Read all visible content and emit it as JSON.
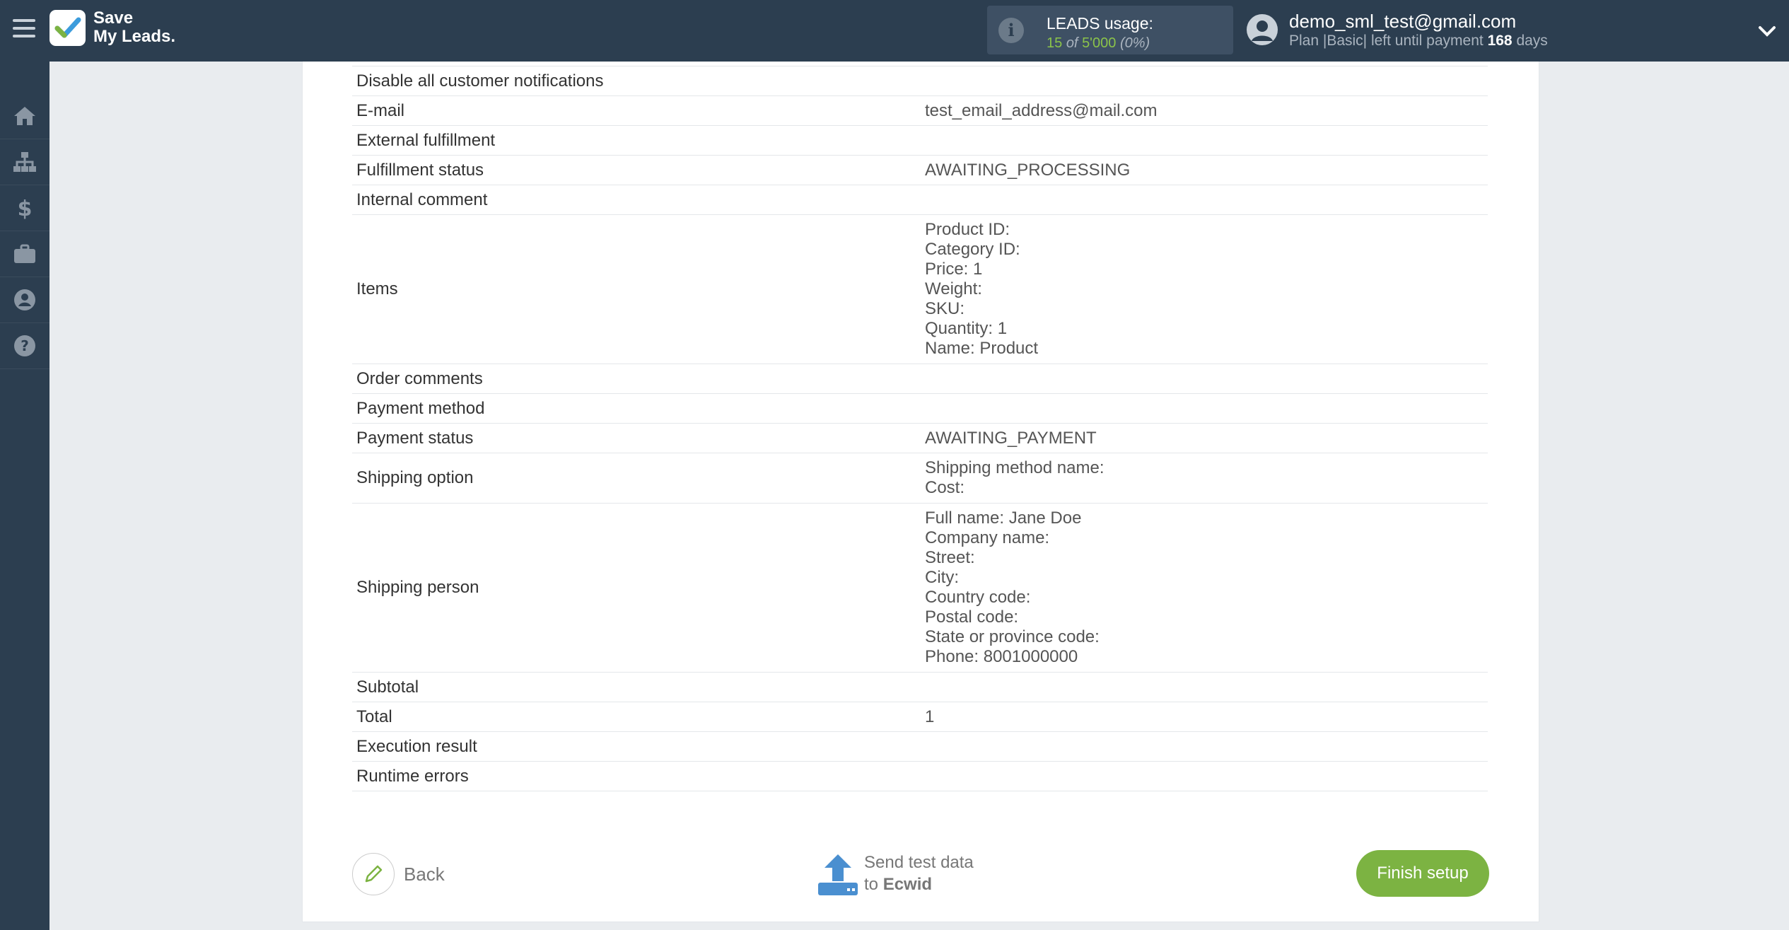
{
  "brand": {
    "line1": "Save",
    "line2": "My Leads."
  },
  "usage": {
    "title": "LEADS usage:",
    "used": "15",
    "of": "of",
    "total": "5'000",
    "percent": "(0%)"
  },
  "user": {
    "email": "demo_sml_test@gmail.com",
    "plan_prefix": "Plan |Basic| left until payment",
    "days": "168",
    "days_suffix": "days"
  },
  "sidebar": {
    "items": [
      "home-icon",
      "sitemap-icon",
      "dollar-icon",
      "briefcase-icon",
      "user-circle-icon",
      "help-icon"
    ]
  },
  "rows": [
    {
      "key": "Disable all customer notifications",
      "value": ""
    },
    {
      "key": "E-mail",
      "value": "test_email_address@mail.com"
    },
    {
      "key": "External fulfillment",
      "value": ""
    },
    {
      "key": "Fulfillment status",
      "value": "AWAITING_PROCESSING"
    },
    {
      "key": "Internal comment",
      "value": ""
    },
    {
      "key": "Items",
      "value": "Product ID:\nCategory ID:\nPrice: 1\nWeight:\nSKU:\nQuantity: 1\nName: Product"
    },
    {
      "key": "Order comments",
      "value": ""
    },
    {
      "key": "Payment method",
      "value": ""
    },
    {
      "key": "Payment status",
      "value": "AWAITING_PAYMENT"
    },
    {
      "key": "Shipping option",
      "value": "Shipping method name:\nCost:"
    },
    {
      "key": "Shipping person",
      "value": "Full name: Jane Doe\nCompany name:\nStreet:\nCity:\nCountry code:\nPostal code:\nState or province code:\nPhone: 8001000000"
    },
    {
      "key": "Subtotal",
      "value": ""
    },
    {
      "key": "Total",
      "value": "1"
    },
    {
      "key": "Execution result",
      "value": ""
    },
    {
      "key": "Runtime errors",
      "value": ""
    }
  ],
  "actions": {
    "back": "Back",
    "send_line1": "Send test data",
    "send_to": "to",
    "send_target": "Ecwid",
    "finish": "Finish setup"
  },
  "colors": {
    "topbar": "#2c3e50",
    "accent_green": "#7cb342",
    "upload_blue": "#4a8fd0"
  }
}
